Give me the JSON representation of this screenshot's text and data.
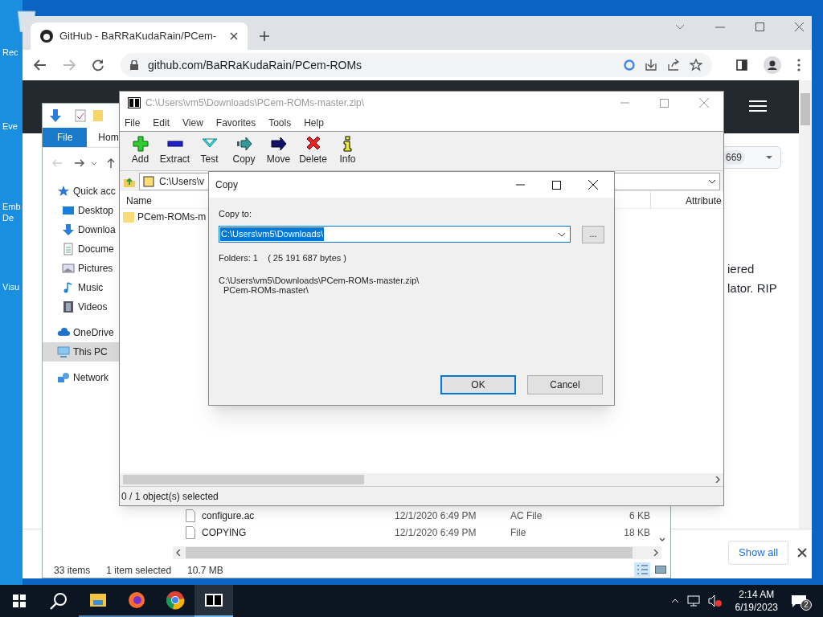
{
  "desktop_icons": [
    {
      "lines": [
        "Rec"
      ]
    },
    {
      "lines": [
        "Eve"
      ]
    },
    {
      "lines": [
        "Emb",
        "De"
      ]
    },
    {
      "lines": [
        "Visu"
      ]
    }
  ],
  "browser": {
    "tab_title": "GitHub - BaRRaKudaRain/PCem-",
    "url": "github.com/BaRRaKudaRain/PCem-ROMs",
    "counter": "669",
    "text_lines": [
      "iered",
      "lator. RIP"
    ],
    "download_bar": {
      "button": "Show all"
    }
  },
  "explorer": {
    "ribbon_tabs": [
      {
        "label": "File",
        "selected": true
      },
      {
        "label": "Hom",
        "selected": false
      }
    ],
    "nav_items": [
      {
        "label": "Quick acc",
        "kind": "star",
        "selected": false
      },
      {
        "label": "Desktop",
        "kind": "desktop",
        "selected": false
      },
      {
        "label": "Downloa",
        "kind": "download",
        "selected": false
      },
      {
        "label": "Docume",
        "kind": "document",
        "selected": false
      },
      {
        "label": "Pictures",
        "kind": "picture",
        "selected": false
      },
      {
        "label": "Music",
        "kind": "music",
        "selected": false
      },
      {
        "label": "Videos",
        "kind": "video",
        "selected": false
      },
      {
        "label": "OneDrive",
        "kind": "cloud",
        "selected": false
      },
      {
        "label": "This PC",
        "kind": "pc",
        "selected": true
      },
      {
        "label": "Network",
        "kind": "network",
        "selected": false
      }
    ],
    "rows": [
      {
        "name": "configure.ac",
        "date": "12/1/2020 6:49 PM",
        "type": "AC File",
        "size": "6 KB"
      },
      {
        "name": "COPYING",
        "date": "12/1/2020 6:49 PM",
        "type": "File",
        "size": "18 KB"
      }
    ],
    "status": [
      "33 items",
      "1 item selected",
      "10.7 MB"
    ]
  },
  "sevenzip": {
    "title": "C:\\Users\\vm5\\Downloads\\PCem-ROMs-master.zip\\",
    "menu": [
      "File",
      "Edit",
      "View",
      "Favorites",
      "Tools",
      "Help"
    ],
    "toolbar": [
      {
        "label": "Add",
        "kind": "add"
      },
      {
        "label": "Extract",
        "kind": "extract"
      },
      {
        "label": "Test",
        "kind": "test"
      },
      {
        "label": "Copy",
        "kind": "copy"
      },
      {
        "label": "Move",
        "kind": "move"
      },
      {
        "label": "Delete",
        "kind": "delete"
      },
      {
        "label": "Info",
        "kind": "info"
      }
    ],
    "address": "C:\\Users\\v",
    "columns": [
      "Name",
      "Attribute"
    ],
    "rows": [
      {
        "name": "PCem-ROMs-m"
      }
    ],
    "status": "0 / 1 object(s) selected"
  },
  "dialog": {
    "title": "Copy",
    "label": "Copy to:",
    "value": "C:\\Users\\vm5\\Downloads\\",
    "browse": "...",
    "folders": "Folders: 1    ( 25 191 687 bytes )",
    "paths": [
      "C:\\Users\\vm5\\Downloads\\PCem-ROMs-master.zip\\",
      "PCem-ROMs-master\\"
    ],
    "buttons": [
      {
        "label": "OK",
        "kind": "default"
      },
      {
        "label": "Cancel",
        "kind": "normal"
      }
    ]
  },
  "taskbar": {
    "apps": [
      {
        "kind": "explorer",
        "selected": false
      },
      {
        "kind": "firefox",
        "selected": false
      },
      {
        "kind": "chrome",
        "selected": false
      },
      {
        "kind": "sevenzip",
        "selected": true
      }
    ],
    "time": "2:14 AM",
    "date": "6/19/2023",
    "notifications": "2"
  }
}
